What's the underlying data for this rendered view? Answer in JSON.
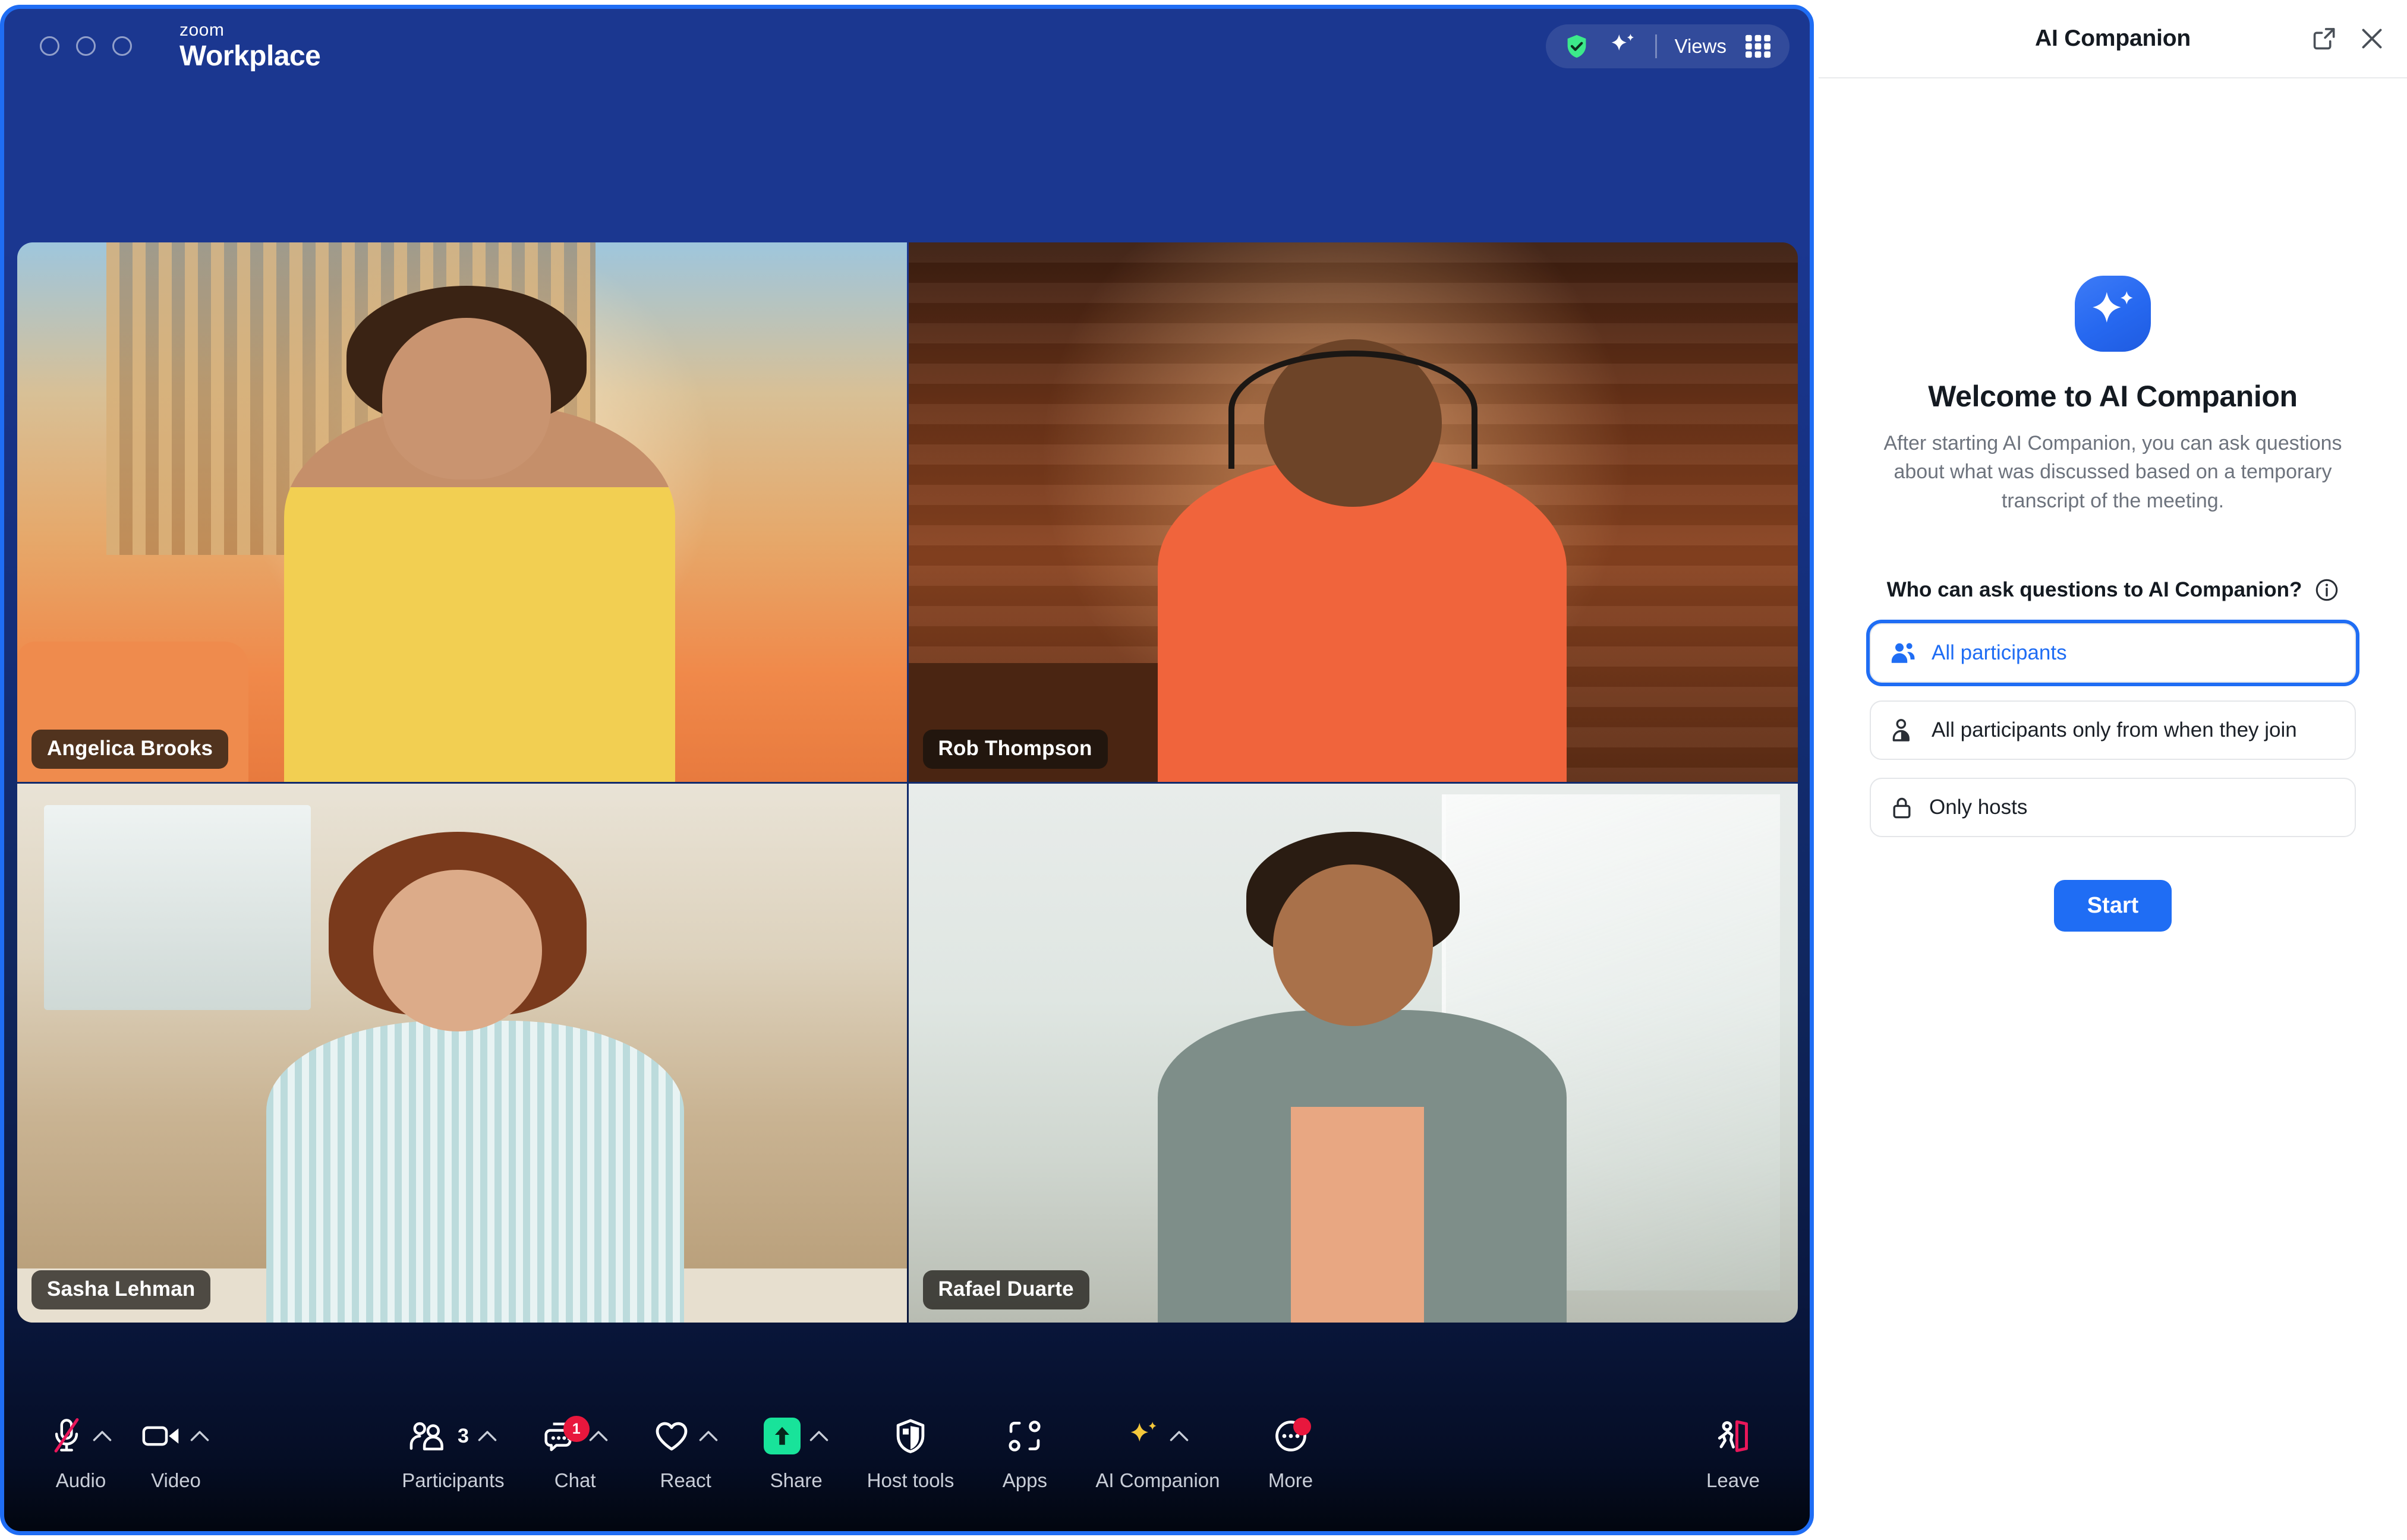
{
  "window": {
    "brand_line1": "zoom",
    "brand_line2": "Workplace",
    "traffic_lights": [
      "close",
      "minimize",
      "maximize"
    ],
    "header_controls": {
      "security_icon": "shield-check-icon",
      "ai_icon": "ai-sparkle-icon",
      "views_label": "Views",
      "views_grid_icon": "grid-icon"
    }
  },
  "gallery": {
    "participants": [
      {
        "name": "Angelica Brooks"
      },
      {
        "name": "Rob Thompson"
      },
      {
        "name": "Sasha Lehman"
      },
      {
        "name": "Rafael Duarte"
      }
    ]
  },
  "toolbar": {
    "items": [
      {
        "label": "Audio",
        "icon": "microphone-muted-icon",
        "caret": true,
        "badge": null,
        "count": null
      },
      {
        "label": "Video",
        "icon": "camera-icon",
        "caret": true,
        "badge": null,
        "count": null
      },
      {
        "label": "Participants",
        "icon": "people-icon",
        "caret": true,
        "badge": null,
        "count": "3"
      },
      {
        "label": "Chat",
        "icon": "chat-bubbles-icon",
        "caret": true,
        "badge": "1",
        "count": null
      },
      {
        "label": "React",
        "icon": "heart-icon",
        "caret": true,
        "badge": null,
        "count": null
      },
      {
        "label": "Share",
        "icon": "share-screen-icon",
        "caret": true,
        "badge": null,
        "count": null
      },
      {
        "label": "Host tools",
        "icon": "shield-icon",
        "caret": false,
        "badge": null,
        "count": null
      },
      {
        "label": "Apps",
        "icon": "apps-icon",
        "caret": false,
        "badge": null,
        "count": null
      },
      {
        "label": "AI Companion",
        "icon": "ai-sparkle-gold-icon",
        "caret": true,
        "badge": null,
        "count": null
      },
      {
        "label": "More",
        "icon": "ellipsis-icon",
        "caret": false,
        "badge": "dot",
        "count": null
      },
      {
        "label": "Leave",
        "icon": "leave-door-icon",
        "caret": false,
        "badge": null,
        "count": null
      }
    ]
  },
  "panel": {
    "title": "AI Companion",
    "popout_icon": "pop-out-icon",
    "close_icon": "close-icon",
    "hero_icon": "ai-sparkle-icon",
    "welcome_title": "Welcome to AI Companion",
    "welcome_subtitle": "After starting AI Companion, you can ask questions about what was discussed based on a temporary transcript of the meeting.",
    "question_label": "Who can ask questions to AI Companion?",
    "info_icon": "info-icon",
    "options": [
      {
        "label": "All participants",
        "icon": "people-icon",
        "selected": true
      },
      {
        "label": "All participants only from when they join",
        "icon": "person-partial-icon",
        "selected": false
      },
      {
        "label": "Only hosts",
        "icon": "lock-icon",
        "selected": false
      }
    ],
    "start_label": "Start"
  },
  "colors": {
    "accent_blue": "#1f6df4",
    "window_border": "#1f6df4",
    "badge_red": "#e8173d",
    "share_green": "#18e39a",
    "security_green": "#3ce98a",
    "ai_gold": "#f5c83b",
    "leave_red": "#e8175a",
    "panel_text": "#141a21",
    "panel_muted": "#6d737d"
  }
}
